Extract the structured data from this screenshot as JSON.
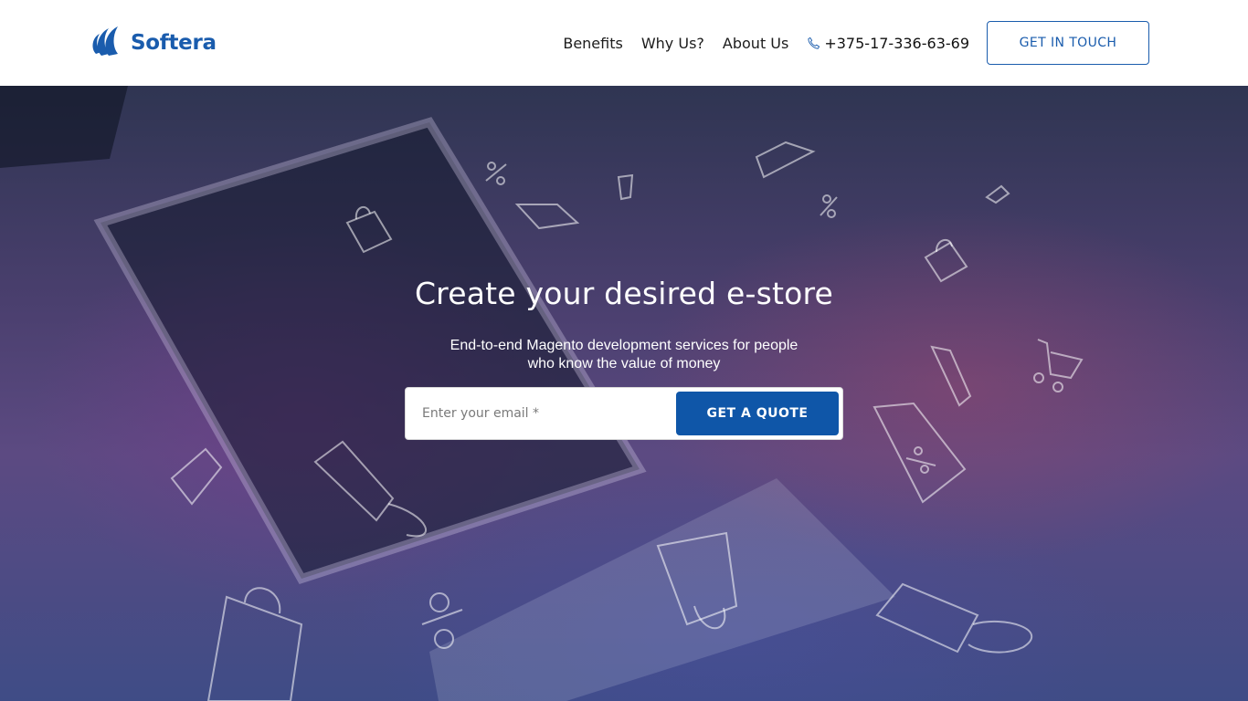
{
  "brand": {
    "name": "Softera",
    "logo_icon": "softera-logo-icon",
    "color": "#1a5cad"
  },
  "nav": {
    "items": [
      {
        "label": "Benefits"
      },
      {
        "label": "Why Us?"
      },
      {
        "label": "About Us"
      }
    ],
    "phone": {
      "icon": "phone-icon",
      "number": "+375-17-336-63-69"
    },
    "cta_label": "GET IN TOUCH"
  },
  "hero": {
    "title": "Create your desired e-store",
    "subtitle": "End-to-end Magento development services for people who know the value of money",
    "email_placeholder": "Enter your email *",
    "email_value": "",
    "submit_label": "GET A QUOTE",
    "accent_color": "#0f56a8",
    "decorations": [
      "shopping-bag-icon",
      "price-tag-icon",
      "percent-icon",
      "shopping-cart-icon"
    ]
  }
}
